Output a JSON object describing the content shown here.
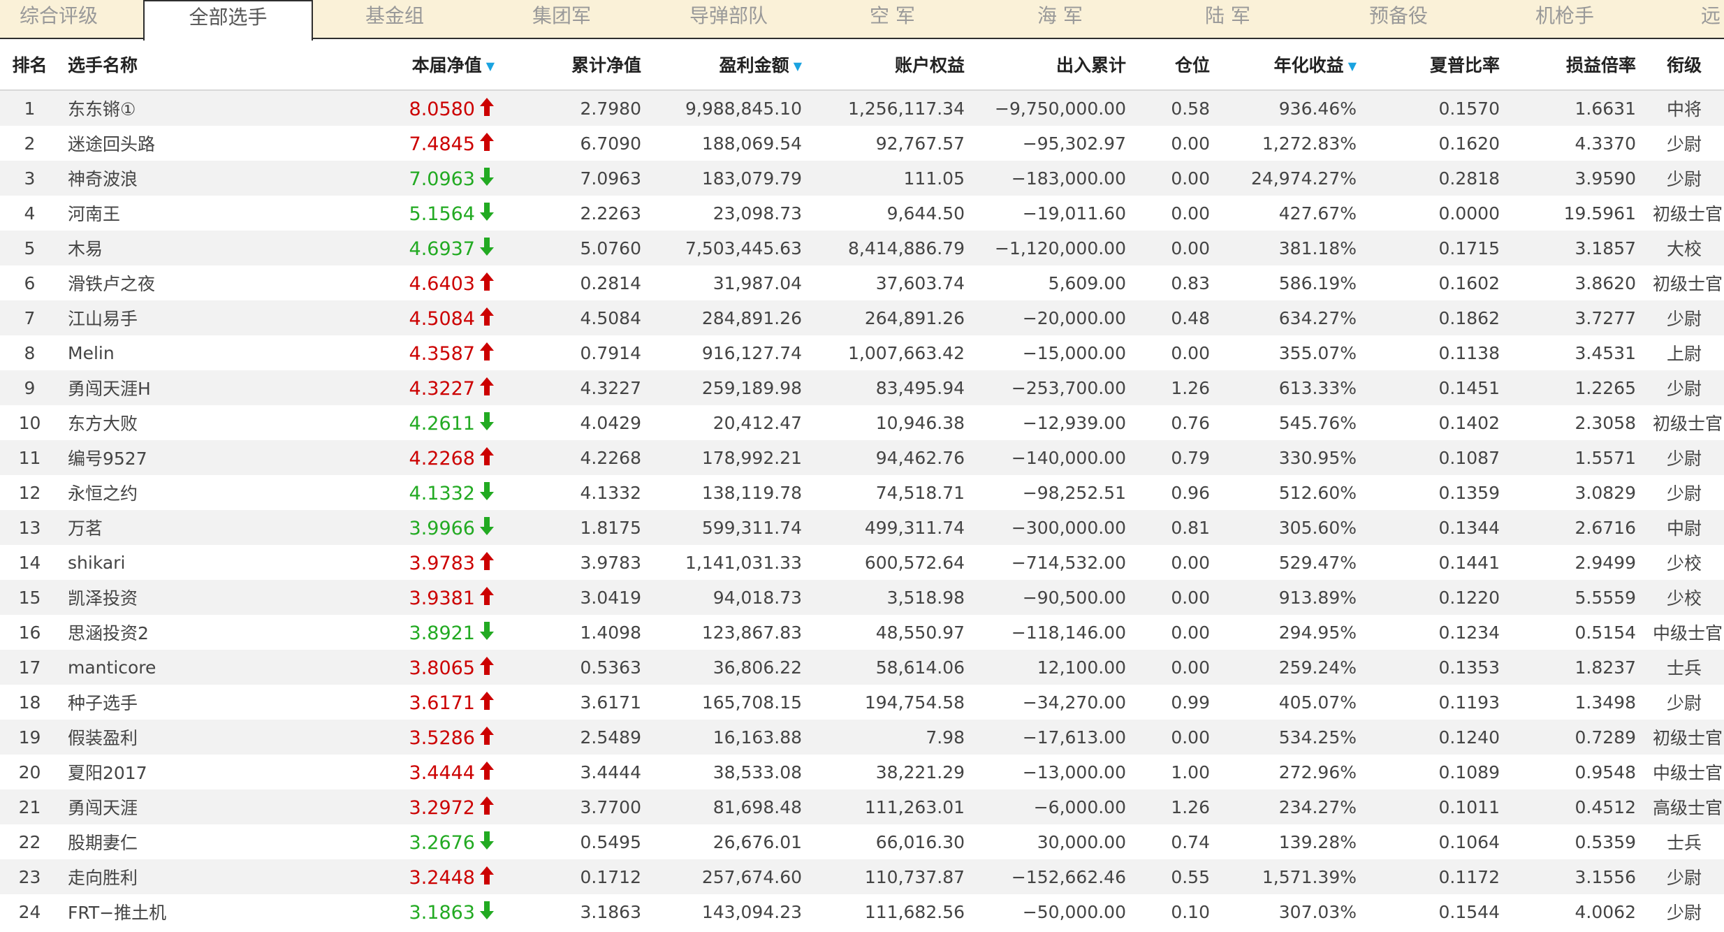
{
  "tabs": [
    "综合评级",
    "全部选手",
    "基金组",
    "集团军",
    "导弹部队",
    "空 军",
    "海 军",
    "陆 军",
    "预备役",
    "机枪手",
    "远"
  ],
  "active_tab": 1,
  "colors": {
    "up": "#cc0000",
    "down": "#22aa22",
    "sort": "#1aa3e0",
    "tabbar_bg": "#faf1d8"
  },
  "icons": {
    "up": "arrow-up-icon",
    "down": "arrow-down-icon",
    "sort": "sort-down-icon"
  },
  "headers": {
    "rank": "排名",
    "name": "选手名称",
    "nav": "本届净值",
    "cum_nav": "累计净值",
    "profit": "盈利金额",
    "equity": "账户权益",
    "inout": "出入累计",
    "position": "仓位",
    "annual": "年化收益",
    "sharpe": "夏普比率",
    "pl_ratio": "损益倍率",
    "grade": "衔级"
  },
  "rows": [
    {
      "rank": "1",
      "name": "东东锵①",
      "nav": "8.0580",
      "dir": "up",
      "cum_nav": "2.7980",
      "profit": "9,988,845.10",
      "equity": "1,256,117.34",
      "inout": "−9,750,000.00",
      "position": "0.58",
      "annual": "936.46%",
      "sharpe": "0.1570",
      "pl_ratio": "1.6631",
      "grade": "中将"
    },
    {
      "rank": "2",
      "name": "迷途回头路",
      "nav": "7.4845",
      "dir": "up",
      "cum_nav": "6.7090",
      "profit": "188,069.54",
      "equity": "92,767.57",
      "inout": "−95,302.97",
      "position": "0.00",
      "annual": "1,272.83%",
      "sharpe": "0.1620",
      "pl_ratio": "4.3370",
      "grade": "少尉"
    },
    {
      "rank": "3",
      "name": "神奇波浪",
      "nav": "7.0963",
      "dir": "down",
      "cum_nav": "7.0963",
      "profit": "183,079.79",
      "equity": "111.05",
      "inout": "−183,000.00",
      "position": "0.00",
      "annual": "24,974.27%",
      "sharpe": "0.2818",
      "pl_ratio": "3.9590",
      "grade": "少尉"
    },
    {
      "rank": "4",
      "name": "河南王",
      "nav": "5.1564",
      "dir": "down",
      "cum_nav": "2.2263",
      "profit": "23,098.73",
      "equity": "9,644.50",
      "inout": "−19,011.60",
      "position": "0.00",
      "annual": "427.67%",
      "sharpe": "0.0000",
      "pl_ratio": "19.5961",
      "grade": "初级士官"
    },
    {
      "rank": "5",
      "name": "木易",
      "nav": "4.6937",
      "dir": "down",
      "cum_nav": "5.0760",
      "profit": "7,503,445.63",
      "equity": "8,414,886.79",
      "inout": "−1,120,000.00",
      "position": "0.00",
      "annual": "381.18%",
      "sharpe": "0.1715",
      "pl_ratio": "3.1857",
      "grade": "大校"
    },
    {
      "rank": "6",
      "name": "滑铁卢之夜",
      "nav": "4.6403",
      "dir": "up",
      "cum_nav": "0.2814",
      "profit": "31,987.04",
      "equity": "37,603.74",
      "inout": "5,609.00",
      "position": "0.83",
      "annual": "586.19%",
      "sharpe": "0.1602",
      "pl_ratio": "3.8620",
      "grade": "初级士官"
    },
    {
      "rank": "7",
      "name": "江山易手",
      "nav": "4.5084",
      "dir": "up",
      "cum_nav": "4.5084",
      "profit": "284,891.26",
      "equity": "264,891.26",
      "inout": "−20,000.00",
      "position": "0.48",
      "annual": "634.27%",
      "sharpe": "0.1862",
      "pl_ratio": "3.7277",
      "grade": "少尉"
    },
    {
      "rank": "8",
      "name": "Melin",
      "nav": "4.3587",
      "dir": "up",
      "cum_nav": "0.7914",
      "profit": "916,127.74",
      "equity": "1,007,663.42",
      "inout": "−15,000.00",
      "position": "0.00",
      "annual": "355.07%",
      "sharpe": "0.1138",
      "pl_ratio": "3.4531",
      "grade": "上尉"
    },
    {
      "rank": "9",
      "name": "勇闯天涯H",
      "nav": "4.3227",
      "dir": "up",
      "cum_nav": "4.3227",
      "profit": "259,189.98",
      "equity": "83,495.94",
      "inout": "−253,700.00",
      "position": "1.26",
      "annual": "613.33%",
      "sharpe": "0.1451",
      "pl_ratio": "1.2265",
      "grade": "少尉"
    },
    {
      "rank": "10",
      "name": "东方大败",
      "nav": "4.2611",
      "dir": "down",
      "cum_nav": "4.0429",
      "profit": "20,412.47",
      "equity": "10,946.38",
      "inout": "−12,939.00",
      "position": "0.76",
      "annual": "545.76%",
      "sharpe": "0.1402",
      "pl_ratio": "2.3058",
      "grade": "初级士官"
    },
    {
      "rank": "11",
      "name": "编号9527",
      "nav": "4.2268",
      "dir": "up",
      "cum_nav": "4.2268",
      "profit": "178,992.21",
      "equity": "94,462.76",
      "inout": "−140,000.00",
      "position": "0.79",
      "annual": "330.95%",
      "sharpe": "0.1087",
      "pl_ratio": "1.5571",
      "grade": "少尉"
    },
    {
      "rank": "12",
      "name": "永恒之约",
      "nav": "4.1332",
      "dir": "down",
      "cum_nav": "4.1332",
      "profit": "138,119.78",
      "equity": "74,518.71",
      "inout": "−98,252.51",
      "position": "0.96",
      "annual": "512.60%",
      "sharpe": "0.1359",
      "pl_ratio": "3.0829",
      "grade": "少尉"
    },
    {
      "rank": "13",
      "name": "万茗",
      "nav": "3.9966",
      "dir": "down",
      "cum_nav": "1.8175",
      "profit": "599,311.74",
      "equity": "499,311.74",
      "inout": "−300,000.00",
      "position": "0.81",
      "annual": "305.60%",
      "sharpe": "0.1344",
      "pl_ratio": "2.6716",
      "grade": "中尉"
    },
    {
      "rank": "14",
      "name": "shikari",
      "nav": "3.9783",
      "dir": "up",
      "cum_nav": "3.9783",
      "profit": "1,141,031.33",
      "equity": "600,572.64",
      "inout": "−714,532.00",
      "position": "0.00",
      "annual": "529.47%",
      "sharpe": "0.1441",
      "pl_ratio": "2.9499",
      "grade": "少校"
    },
    {
      "rank": "15",
      "name": "凯泽投资",
      "nav": "3.9381",
      "dir": "up",
      "cum_nav": "3.0419",
      "profit": "94,018.73",
      "equity": "3,518.98",
      "inout": "−90,500.00",
      "position": "0.00",
      "annual": "913.89%",
      "sharpe": "0.1220",
      "pl_ratio": "5.5559",
      "grade": "少校"
    },
    {
      "rank": "16",
      "name": "思涵投资2",
      "nav": "3.8921",
      "dir": "down",
      "cum_nav": "1.4098",
      "profit": "123,867.83",
      "equity": "48,550.97",
      "inout": "−118,146.00",
      "position": "0.00",
      "annual": "294.95%",
      "sharpe": "0.1234",
      "pl_ratio": "0.5154",
      "grade": "中级士官"
    },
    {
      "rank": "17",
      "name": "manticore",
      "nav": "3.8065",
      "dir": "up",
      "cum_nav": "0.5363",
      "profit": "36,806.22",
      "equity": "58,614.06",
      "inout": "12,100.00",
      "position": "0.00",
      "annual": "259.24%",
      "sharpe": "0.1353",
      "pl_ratio": "1.8237",
      "grade": "士兵"
    },
    {
      "rank": "18",
      "name": "种子选手",
      "nav": "3.6171",
      "dir": "up",
      "cum_nav": "3.6171",
      "profit": "165,708.15",
      "equity": "194,754.58",
      "inout": "−34,270.00",
      "position": "0.99",
      "annual": "405.07%",
      "sharpe": "0.1193",
      "pl_ratio": "1.3498",
      "grade": "少尉"
    },
    {
      "rank": "19",
      "name": "假装盈利",
      "nav": "3.5286",
      "dir": "up",
      "cum_nav": "2.5489",
      "profit": "16,163.88",
      "equity": "7.98",
      "inout": "−17,613.00",
      "position": "0.00",
      "annual": "534.25%",
      "sharpe": "0.1240",
      "pl_ratio": "0.7289",
      "grade": "初级士官"
    },
    {
      "rank": "20",
      "name": "夏阳2017",
      "nav": "3.4444",
      "dir": "up",
      "cum_nav": "3.4444",
      "profit": "38,533.08",
      "equity": "38,221.29",
      "inout": "−13,000.00",
      "position": "1.00",
      "annual": "272.96%",
      "sharpe": "0.1089",
      "pl_ratio": "0.9548",
      "grade": "中级士官"
    },
    {
      "rank": "21",
      "name": "勇闯天涯",
      "nav": "3.2972",
      "dir": "up",
      "cum_nav": "3.7700",
      "profit": "81,698.48",
      "equity": "111,263.01",
      "inout": "−6,000.00",
      "position": "1.26",
      "annual": "234.27%",
      "sharpe": "0.1011",
      "pl_ratio": "0.4512",
      "grade": "高级士官"
    },
    {
      "rank": "22",
      "name": "股期妻仁",
      "nav": "3.2676",
      "dir": "down",
      "cum_nav": "0.5495",
      "profit": "26,676.01",
      "equity": "66,016.30",
      "inout": "30,000.00",
      "position": "0.74",
      "annual": "139.28%",
      "sharpe": "0.1064",
      "pl_ratio": "0.5359",
      "grade": "士兵"
    },
    {
      "rank": "23",
      "name": "走向胜利",
      "nav": "3.2448",
      "dir": "up",
      "cum_nav": "0.1712",
      "profit": "257,674.60",
      "equity": "110,737.87",
      "inout": "−152,662.46",
      "position": "0.55",
      "annual": "1,571.39%",
      "sharpe": "0.1172",
      "pl_ratio": "3.1556",
      "grade": "少尉"
    },
    {
      "rank": "24",
      "name": "FRT−推土机",
      "nav": "3.1863",
      "dir": "down",
      "cum_nav": "3.1863",
      "profit": "143,094.23",
      "equity": "111,682.56",
      "inout": "−50,000.00",
      "position": "0.10",
      "annual": "307.03%",
      "sharpe": "0.1544",
      "pl_ratio": "4.0062",
      "grade": "少尉"
    }
  ]
}
